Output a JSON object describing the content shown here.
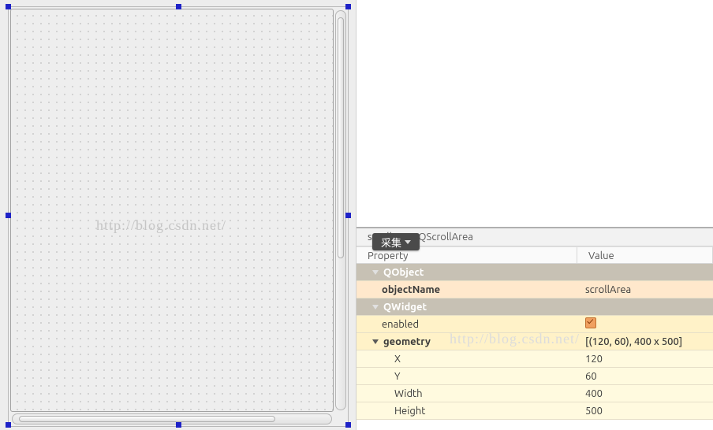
{
  "canvas": {
    "watermark": "http://blog.csdn.net/"
  },
  "capture_button": {
    "label": "采集"
  },
  "property_panel": {
    "object_name_label": "scrollArea",
    "class_name": ": QScrollArea",
    "columns": {
      "property": "Property",
      "value": "Value"
    },
    "groups": {
      "qobject": {
        "label": "QObject",
        "rows": [
          {
            "name": "objectName",
            "value": "scrollArea"
          }
        ]
      },
      "qwidget": {
        "label": "QWidget",
        "rows": [
          {
            "name": "enabled",
            "value_checkbox": true
          },
          {
            "name": "geometry",
            "value": "[(120, 60), 400 x 500]",
            "children": [
              {
                "name": "X",
                "value": "120"
              },
              {
                "name": "Y",
                "value": "60"
              },
              {
                "name": "Width",
                "value": "400"
              },
              {
                "name": "Height",
                "value": "500"
              }
            ]
          }
        ]
      }
    }
  },
  "watermark_right": "http://blog.csdn.net/"
}
